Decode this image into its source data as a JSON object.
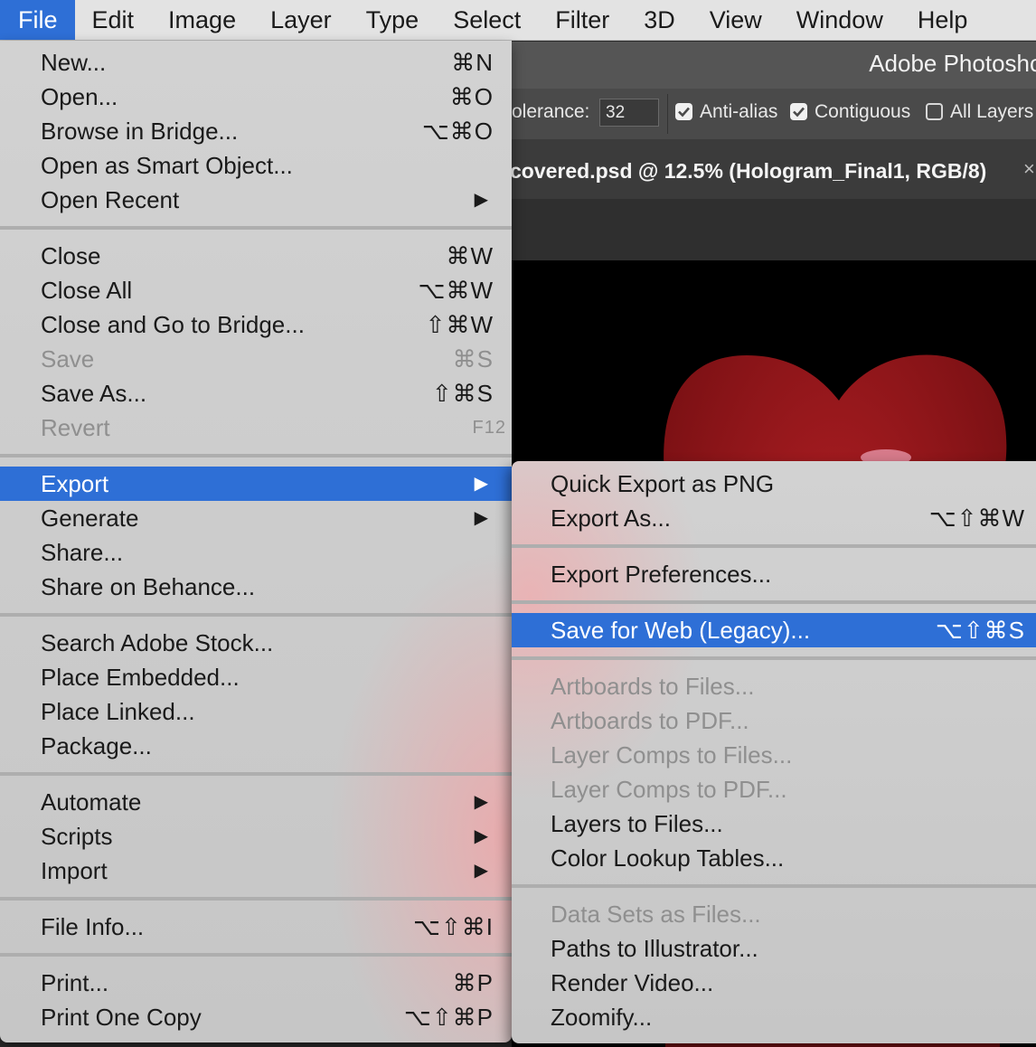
{
  "menubar": {
    "items": [
      "File",
      "Edit",
      "Image",
      "Layer",
      "Type",
      "Select",
      "Filter",
      "3D",
      "View",
      "Window",
      "Help"
    ]
  },
  "photoshop": {
    "title": "Adobe Photoshc",
    "options": {
      "tolerance_label": "olerance:",
      "tolerance_value": "32",
      "anti_alias": "Anti-alias",
      "contiguous": "Contiguous",
      "all_layers": "All Layers"
    },
    "doc_tab": "covered.psd @ 12.5% (Hologram_Final1, RGB/8)",
    "tab_close": "×"
  },
  "file_menu": {
    "groups": [
      [
        {
          "label": "New...",
          "shortcut": "⌘N"
        },
        {
          "label": "Open...",
          "shortcut": "⌘O"
        },
        {
          "label": "Browse in Bridge...",
          "shortcut": "⌥⌘O"
        },
        {
          "label": "Open as Smart Object...",
          "shortcut": ""
        },
        {
          "label": "Open Recent",
          "submenu": true
        }
      ],
      [
        {
          "label": "Close",
          "shortcut": "⌘W"
        },
        {
          "label": "Close All",
          "shortcut": "⌥⌘W"
        },
        {
          "label": "Close and Go to Bridge...",
          "shortcut": "⇧⌘W"
        },
        {
          "label": "Save",
          "shortcut": "⌘S",
          "disabled": true
        },
        {
          "label": "Save As...",
          "shortcut": "⇧⌘S"
        },
        {
          "label": "Revert",
          "shortcut": "F12",
          "disabled": true
        }
      ],
      [
        {
          "label": "Export",
          "submenu": true,
          "highlighted": true
        },
        {
          "label": "Generate",
          "submenu": true
        },
        {
          "label": "Share...",
          "shortcut": ""
        },
        {
          "label": "Share on Behance...",
          "shortcut": ""
        }
      ],
      [
        {
          "label": "Search Adobe Stock...",
          "shortcut": ""
        },
        {
          "label": "Place Embedded...",
          "shortcut": ""
        },
        {
          "label": "Place Linked...",
          "shortcut": ""
        },
        {
          "label": "Package...",
          "shortcut": ""
        }
      ],
      [
        {
          "label": "Automate",
          "submenu": true
        },
        {
          "label": "Scripts",
          "submenu": true
        },
        {
          "label": "Import",
          "submenu": true
        }
      ],
      [
        {
          "label": "File Info...",
          "shortcut": "⌥⇧⌘I"
        }
      ],
      [
        {
          "label": "Print...",
          "shortcut": "⌘P"
        },
        {
          "label": "Print One Copy",
          "shortcut": "⌥⇧⌘P"
        }
      ]
    ]
  },
  "export_menu": {
    "groups": [
      [
        {
          "label": "Quick Export as PNG",
          "shortcut": ""
        },
        {
          "label": "Export As...",
          "shortcut": "⌥⇧⌘W"
        }
      ],
      [
        {
          "label": "Export Preferences...",
          "shortcut": ""
        }
      ],
      [
        {
          "label": "Save for Web (Legacy)...",
          "shortcut": "⌥⇧⌘S",
          "highlighted": true
        }
      ],
      [
        {
          "label": "Artboards to Files...",
          "disabled": true
        },
        {
          "label": "Artboards to PDF...",
          "disabled": true
        },
        {
          "label": "Layer Comps to Files...",
          "disabled": true
        },
        {
          "label": "Layer Comps to PDF...",
          "disabled": true
        },
        {
          "label": "Layers to Files..."
        },
        {
          "label": "Color Lookup Tables..."
        }
      ],
      [
        {
          "label": "Data Sets as Files...",
          "disabled": true
        },
        {
          "label": "Paths to Illustrator..."
        },
        {
          "label": "Render Video..."
        },
        {
          "label": "Zoomify..."
        }
      ]
    ]
  },
  "colors": {
    "highlight": "#2e6fd6",
    "menu_bg": "#cbcbcb",
    "disabled_text": "#8f8f8f"
  },
  "icons": {
    "submenu": "▶",
    "checkbox_checked": "checkbox-checked-icon",
    "checkbox_unchecked": "checkbox-unchecked-icon"
  }
}
